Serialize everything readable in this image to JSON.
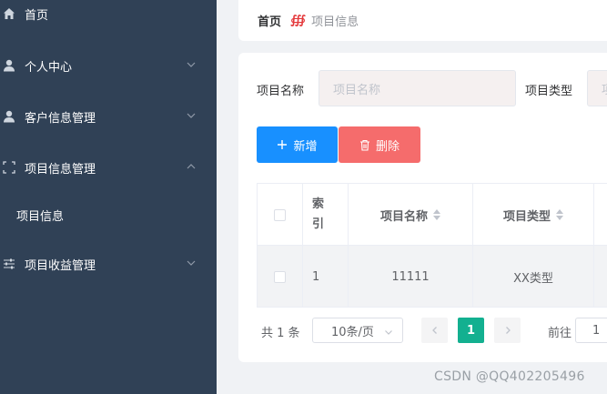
{
  "sidebar": {
    "items": [
      {
        "label": "首页",
        "icon": "home-icon"
      },
      {
        "label": "个人中心",
        "icon": "user-icon"
      },
      {
        "label": "客户信息管理",
        "icon": "user-icon"
      },
      {
        "label": "项目信息管理",
        "icon": "fullscreen-icon"
      },
      {
        "label": "项目收益管理",
        "icon": "sliders-icon"
      }
    ],
    "subitem": "项目信息"
  },
  "breadcrumb": {
    "home": "首页",
    "separator": "∰",
    "current": "项目信息"
  },
  "search": {
    "name_label": "项目名称",
    "name_placeholder": "项目名称",
    "type_label": "项目类型",
    "type_placeholder": "项"
  },
  "toolbar": {
    "add_label": "新增",
    "delete_label": "删除"
  },
  "table": {
    "headers": [
      "索引",
      "项目名称",
      "项目类型"
    ],
    "index_header_line1": "索",
    "index_header_line2": "引",
    "rows": [
      {
        "index": "1",
        "name": "11111",
        "type": "XX类型"
      }
    ]
  },
  "pagination": {
    "total": "共 1 条",
    "page_size": "10条/页",
    "current_page": "1",
    "goto_label": "前往",
    "goto_value": "1"
  },
  "watermark": "CSDN @QQ402205496",
  "colors": {
    "sidebar_bg": "#304156",
    "primary": "#1890ff",
    "danger": "#f56c6c",
    "pager_active": "#13b090"
  }
}
